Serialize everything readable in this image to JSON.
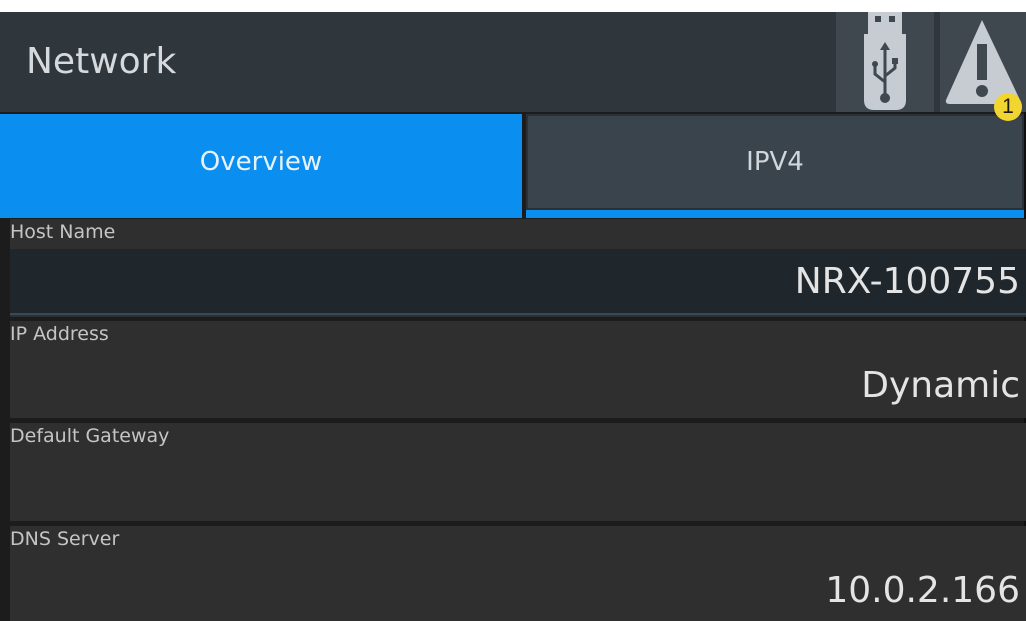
{
  "header": {
    "title": "Network",
    "usb_icon": "usb-icon",
    "warning_icon": "warning-icon",
    "warning_badge": "1"
  },
  "tabs": [
    {
      "label": "Overview",
      "active": true
    },
    {
      "label": "IPV4",
      "active": false
    }
  ],
  "fields": [
    {
      "label": "Host Name",
      "value": "NRX-100755",
      "editable": true
    },
    {
      "label": "IP Address",
      "value": "Dynamic"
    },
    {
      "label": "Default Gateway",
      "value": ""
    },
    {
      "label": "DNS Server",
      "value": "10.0.2.166"
    }
  ],
  "colors": {
    "accent": "#0a8ff0",
    "header_bg": "#2f363c",
    "badge": "#f2d62f"
  }
}
